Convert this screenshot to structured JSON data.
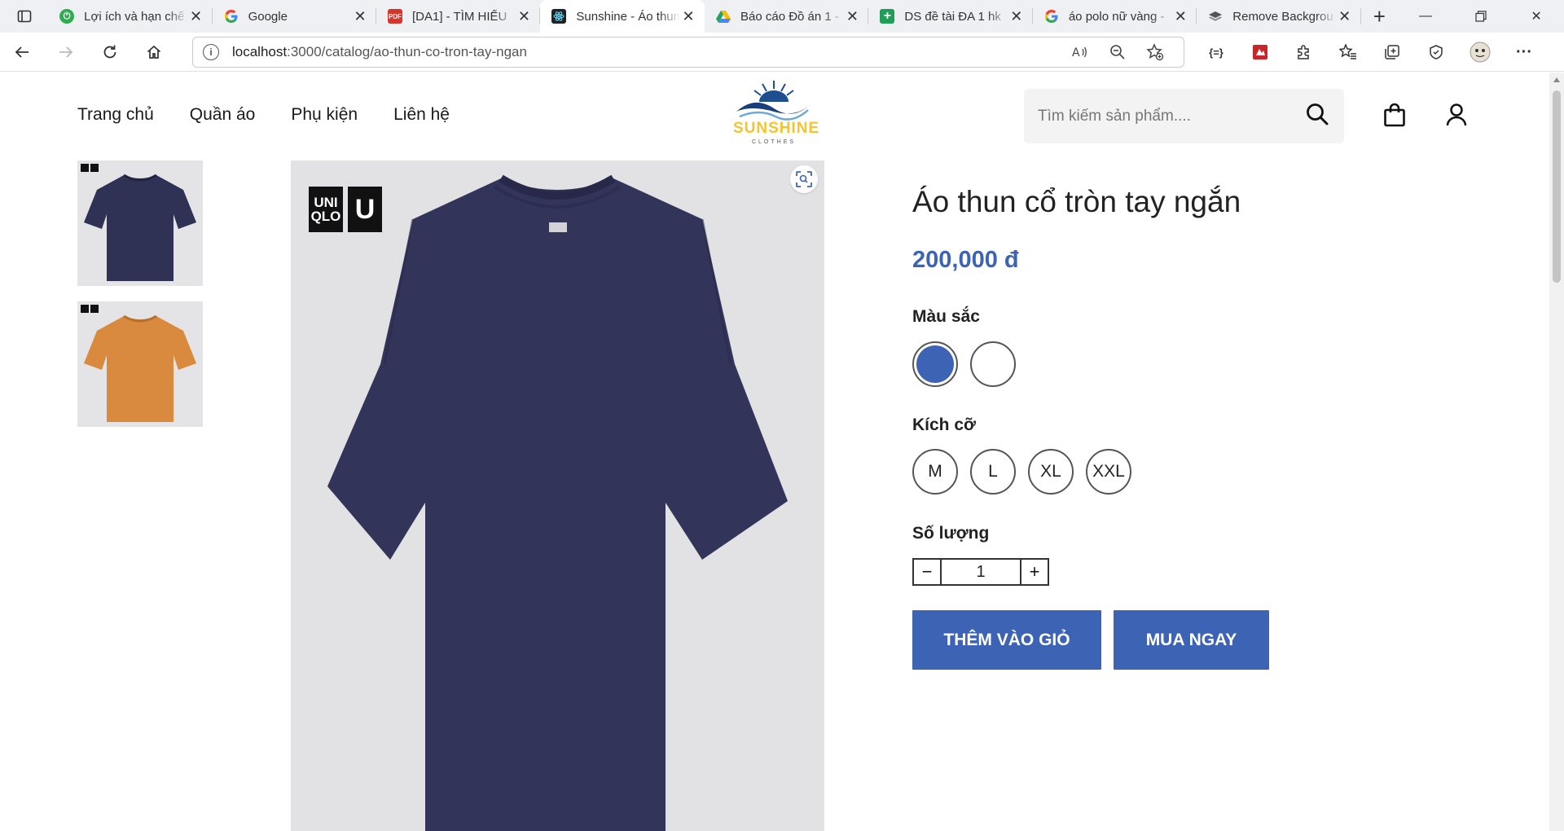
{
  "browser": {
    "tabs": [
      {
        "title": "Lợi ích và hạn chế",
        "favicon": "power-green-icon",
        "active": false
      },
      {
        "title": "Google",
        "favicon": "google-icon",
        "active": false
      },
      {
        "title": "[DA1] - TÌM HIỂU",
        "favicon": "pdf-icon",
        "active": false
      },
      {
        "title": "Sunshine - Áo thun",
        "favicon": "react-icon",
        "active": true
      },
      {
        "title": "Báo cáo Đồ án 1 -",
        "favicon": "google-drive-icon",
        "active": false
      },
      {
        "title": "DS đề tài ĐA 1 hk",
        "favicon": "google-sheets-icon",
        "active": false
      },
      {
        "title": "áo polo nữ vàng -",
        "favicon": "google-icon",
        "active": false
      },
      {
        "title": "Remove Backgrou",
        "favicon": "layers-icon",
        "active": false
      }
    ],
    "address": {
      "host": "localhost",
      "path": ":3000/catalog/ao-thun-co-tron-tay-ngan"
    },
    "ext_code_label": "{=}"
  },
  "site": {
    "nav": [
      "Trang chủ",
      "Quần áo",
      "Phụ kiện",
      "Liên hệ"
    ],
    "logo_text": "SUNSHINE",
    "logo_sub": "CLOTHES",
    "search_placeholder": "Tìm kiếm sản phẩm...."
  },
  "product": {
    "title": "Áo thun cổ tròn tay ngắn",
    "price": "200,000 đ",
    "color_label": "Màu sắc",
    "colors": [
      "#3d63b4",
      "#ffffff"
    ],
    "size_label": "Kích cỡ",
    "sizes": [
      "M",
      "L",
      "XL",
      "XXL"
    ],
    "qty_label": "Số lượng",
    "qty_minus": "−",
    "qty_value": "1",
    "qty_plus": "+",
    "add_to_cart": "THÊM VÀO GIỎ",
    "buy_now": "MUA NGAY",
    "brand_badge": [
      "UNI QLO",
      "U"
    ],
    "thumb_colors": [
      "#2f3155",
      "#d98a3e"
    ],
    "main_color": "#33345a"
  },
  "colors": {
    "accent": "#3d63b4"
  }
}
